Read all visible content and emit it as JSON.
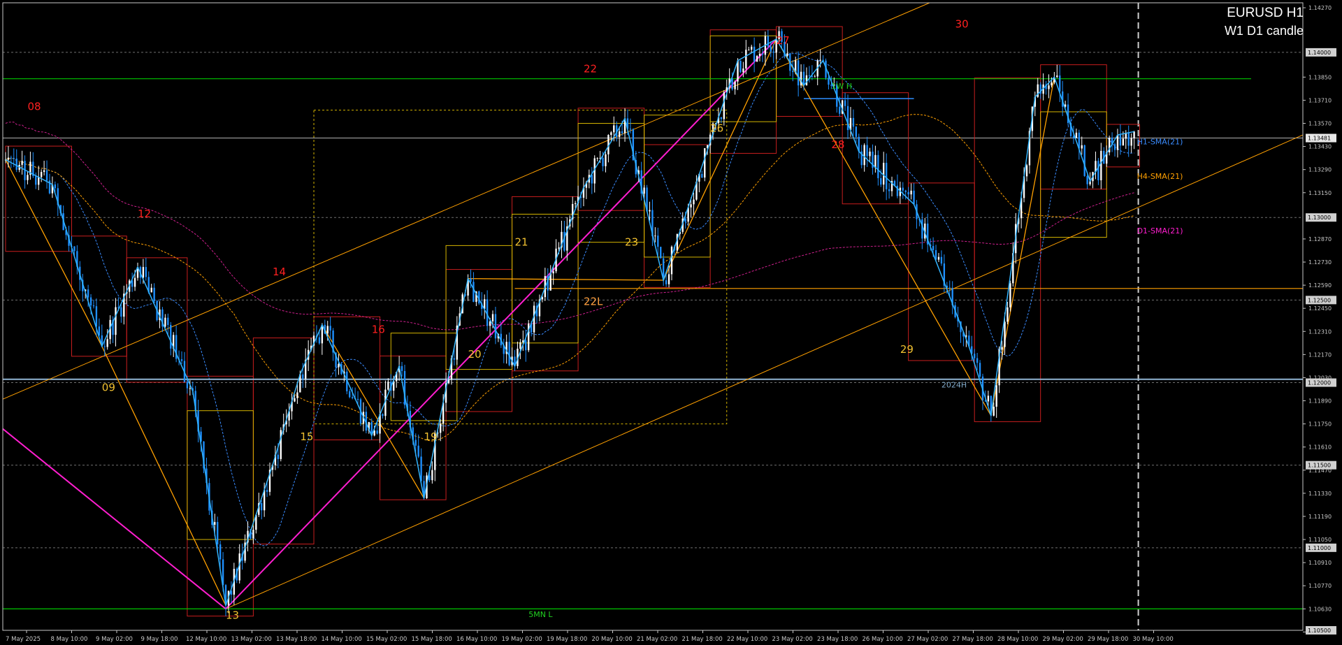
{
  "window": {
    "title": "EURUSD H1",
    "subtitle": "W1 D1 candle"
  },
  "colors": {
    "background": "#000000",
    "candle_up": "#ffffff",
    "candle_down": "#1e90ff",
    "zigzag": "#32b4ff",
    "trendline": "#ffa000",
    "pink_line": "#ff1ecf",
    "green_line": "#00c800",
    "blue_level": "#8fb4d2",
    "daily_box": "#c81e1e",
    "weekly_box": "#d4b400",
    "label_red": "#ff2020",
    "label_yellow": "#f0c030",
    "label_orange": "#ffa040",
    "price_label_bg": "#d0d0d0"
  },
  "chart_data": {
    "type": "candlestick",
    "symbol": "EURUSD",
    "timeframe": "H1",
    "ylim": [
      1.105,
      1.143
    ],
    "y_ticks": [
      "1.14270",
      "1.13850",
      "1.13710",
      "1.13570",
      "1.13430",
      "1.13290",
      "1.13150",
      "1.12870",
      "1.12730",
      "1.12590",
      "1.12450",
      "1.12310",
      "1.12170",
      "1.12030",
      "1.11890",
      "1.11750",
      "1.11610",
      "1.11470",
      "1.11330",
      "1.11190",
      "1.11050",
      "1.10910",
      "1.10770",
      "1.10630",
      "1.10490"
    ],
    "highlighted_prices": [
      "1.14000",
      "1.13481",
      "1.13000",
      "1.12500",
      "1.12000",
      "1.11500",
      "1.11000",
      "1.10500"
    ],
    "x_ticks": [
      "7 May 2025",
      "8 May 10:00",
      "9 May 02:00",
      "9 May 18:00",
      "12 May 10:00",
      "13 May 02:00",
      "13 May 18:00",
      "14 May 10:00",
      "15 May 02:00",
      "15 May 18:00",
      "16 May 10:00",
      "19 May 02:00",
      "19 May 18:00",
      "20 May 10:00",
      "21 May 02:00",
      "21 May 18:00",
      "22 May 10:00",
      "23 May 02:00",
      "23 May 18:00",
      "26 May 10:00",
      "27 May 02:00",
      "27 May 18:00",
      "28 May 10:00",
      "29 May 02:00",
      "29 May 18:00",
      "30 May 10:00"
    ],
    "current_price": 1.13481,
    "levels": [
      {
        "name": "1W H",
        "price": 1.1384
      },
      {
        "name": "5MN L",
        "price": 1.1063
      },
      {
        "name": "2024H",
        "price": 1.1202
      },
      {
        "name": "22L",
        "price": 1.1257
      }
    ],
    "moving_averages": [
      "H1-SMA(21)",
      "H4-SMA(21)",
      "D1-SMA(21)"
    ],
    "day_labels": [
      "08",
      "09",
      "12",
      "13",
      "14",
      "15",
      "16",
      "19",
      "20",
      "21",
      "22",
      "22L",
      "23",
      "26",
      "27",
      "28",
      "29",
      "30"
    ],
    "pivots": [
      {
        "i": 0,
        "p": 1.1335
      },
      {
        "i": 17,
        "p": 1.132
      },
      {
        "i": 35,
        "p": 1.1222
      },
      {
        "i": 48,
        "p": 1.127
      },
      {
        "i": 68,
        "p": 1.1195
      },
      {
        "i": 80,
        "p": 1.1065
      },
      {
        "i": 97,
        "p": 1.115
      },
      {
        "i": 107,
        "p": 1.1205
      },
      {
        "i": 115,
        "p": 1.1235
      },
      {
        "i": 133,
        "p": 1.1168
      },
      {
        "i": 143,
        "p": 1.121
      },
      {
        "i": 152,
        "p": 1.113
      },
      {
        "i": 168,
        "p": 1.1263
      },
      {
        "i": 185,
        "p": 1.121
      },
      {
        "i": 210,
        "p": 1.1318
      },
      {
        "i": 225,
        "p": 1.136
      },
      {
        "i": 239,
        "p": 1.1262
      },
      {
        "i": 266,
        "p": 1.1395
      },
      {
        "i": 280,
        "p": 1.1408
      },
      {
        "i": 290,
        "p": 1.138
      },
      {
        "i": 297,
        "p": 1.1395
      },
      {
        "i": 310,
        "p": 1.134
      },
      {
        "i": 330,
        "p": 1.1308
      },
      {
        "i": 350,
        "p": 1.1222
      },
      {
        "i": 358,
        "p": 1.118
      },
      {
        "i": 374,
        "p": 1.1373
      },
      {
        "i": 381,
        "p": 1.1385
      },
      {
        "i": 394,
        "p": 1.1322
      },
      {
        "i": 404,
        "p": 1.135
      },
      {
        "i": 410,
        "p": 1.1352
      }
    ]
  }
}
